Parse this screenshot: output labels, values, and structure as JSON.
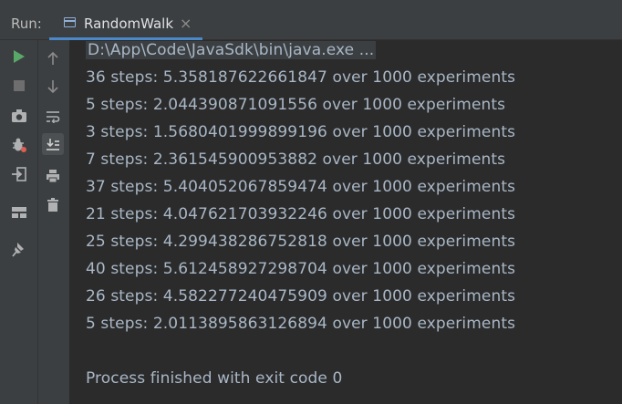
{
  "header": {
    "run_label": "Run:",
    "tab_title": "RandomWalk",
    "tab_close": "×"
  },
  "console": {
    "command": "D:\\App\\Code\\JavaSdk\\bin\\java.exe ...",
    "lines": [
      "36 steps: 5.358187622661847 over 1000 experiments",
      "5 steps: 2.044390871091556 over 1000 experiments",
      "3 steps: 1.5680401999899196 over 1000 experiments",
      "7 steps: 2.361545900953882 over 1000 experiments",
      "37 steps: 5.404052067859474 over 1000 experiments",
      "21 steps: 4.047621703932246 over 1000 experiments",
      "25 steps: 4.299438286752818 over 1000 experiments",
      "40 steps: 5.612458927298704 over 1000 experiments",
      "26 steps: 4.582277240475909 over 1000 experiments",
      "5 steps: 2.0113895863126894 over 1000 experiments"
    ],
    "exit_message": "Process finished with exit code 0"
  },
  "toolbar": {
    "icons": [
      "rerun-icon",
      "stop-icon",
      "camera-icon",
      "debug-icon",
      "login-icon",
      "layout-icon",
      "pin-icon",
      "up-arrow-icon",
      "down-arrow-icon",
      "soft-wrap-icon",
      "scroll-to-end-icon",
      "print-icon",
      "trash-icon"
    ]
  },
  "colors": {
    "background": "#2b2b2b",
    "panel": "#3c3f41",
    "text": "#a9b7c6",
    "accent": "#4a88c7",
    "run_green": "#59a869"
  }
}
